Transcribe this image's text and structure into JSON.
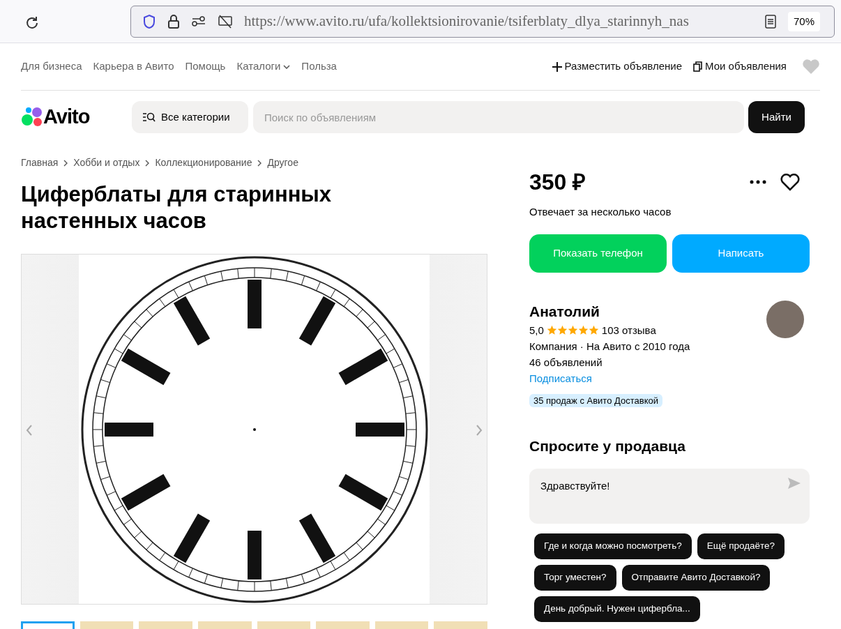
{
  "browser": {
    "url": "https://www.avito.ru/ufa/kollektsionirovanie/tsiferblaty_dlya_starinnyh_nas",
    "zoom": "70%"
  },
  "top_nav": {
    "links": [
      {
        "label": "Для бизнеса",
        "kind": "link"
      },
      {
        "label": "Карьера в Авито",
        "kind": "link"
      },
      {
        "label": "Помощь",
        "kind": "link"
      },
      {
        "label": "Каталоги",
        "kind": "dropdown"
      },
      {
        "label": "Польза",
        "kind": "link"
      }
    ],
    "post_ad": "Разместить объявление",
    "my_ads": "Мои объявления"
  },
  "header": {
    "logo": "Avito",
    "categories_button": "Все категории",
    "search": {
      "placeholder": "Поиск по объявлениям"
    },
    "search_button": "Найти"
  },
  "breadcrumbs": [
    "Главная",
    "Хобби и отдых",
    "Коллекционирование",
    "Другое"
  ],
  "title": "Циферблаты для старинных настенных часов",
  "gallery": {
    "thumbnails": [
      {
        "selected": true
      },
      {
        "selected": false
      },
      {
        "selected": false
      },
      {
        "selected": false
      },
      {
        "selected": false
      },
      {
        "selected": false
      },
      {
        "selected": false
      },
      {
        "selected": false
      }
    ]
  },
  "price": "350 ₽",
  "response_time": "Отвечает за несколько часов",
  "buttons": {
    "phone": "Показать телефон",
    "write": "Написать"
  },
  "seller": {
    "name": "Анатолий",
    "rating": "5,0",
    "stars": 5,
    "reviews": "103 отзыва",
    "info": "Компания · На Авито с 2010 года",
    "listings": "46 объявлений",
    "subscribe": "Подписаться",
    "badge": "35 продаж с Авито Доставкой"
  },
  "ask": {
    "heading": "Спросите у продавца",
    "message": "Здравствуйте!",
    "quick_replies": [
      "Где и когда можно посмотреть?",
      "Ещё продаёте?",
      "Торг уместен?",
      "Отправите Авито Доставкой?",
      "День добрый. Нужен цифербла..."
    ]
  }
}
